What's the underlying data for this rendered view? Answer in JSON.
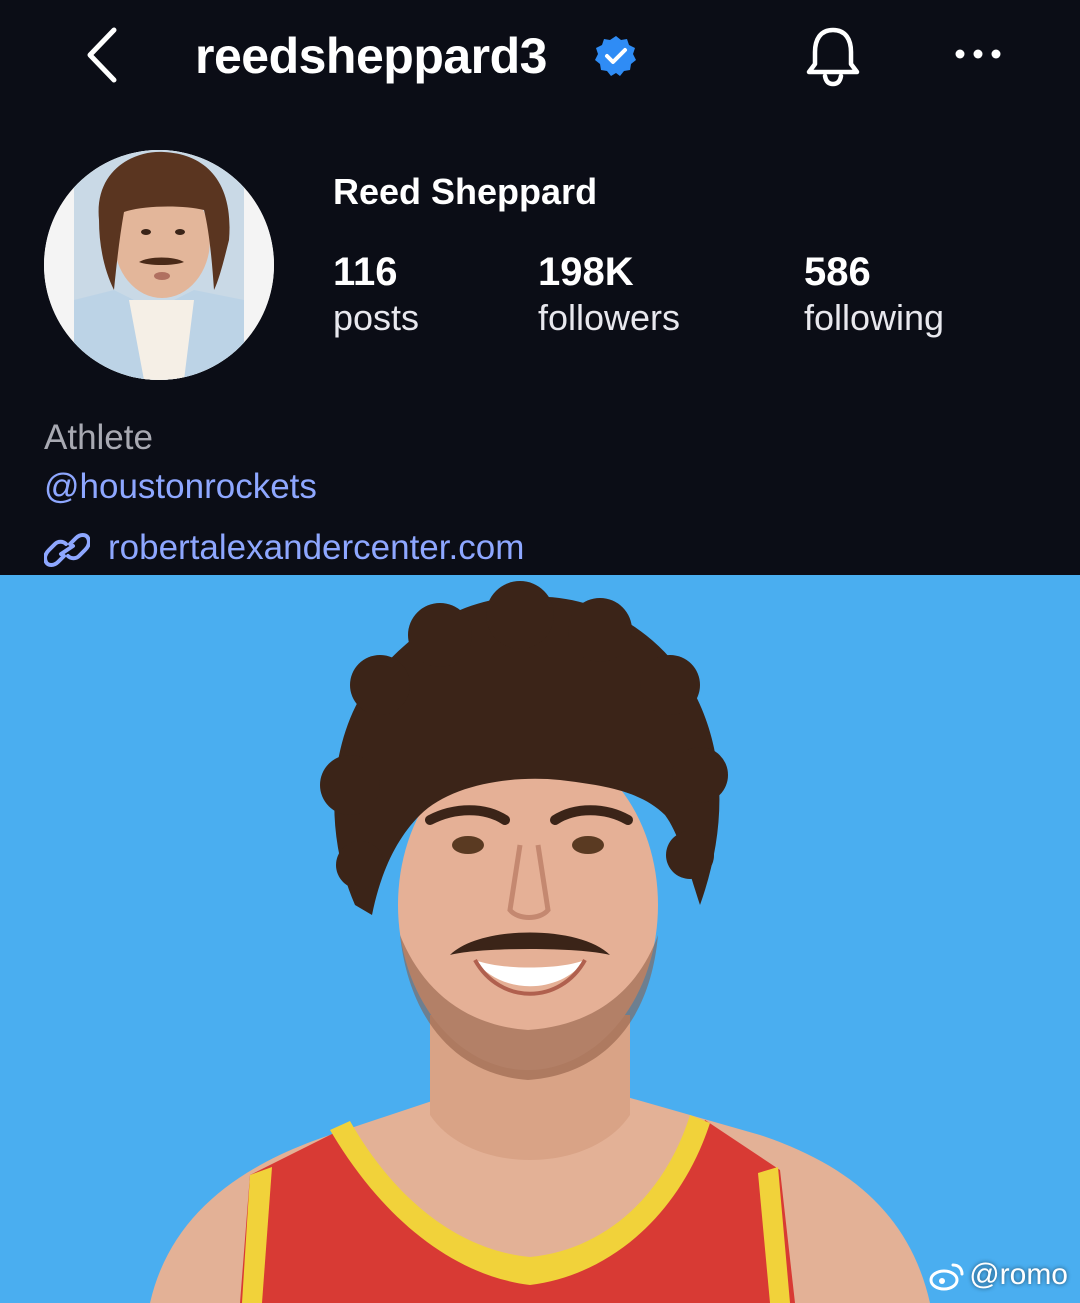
{
  "header": {
    "username": "reedsheppard3",
    "icons": {
      "back": "chevron-left-icon",
      "verified": "verified-badge-icon",
      "notifications": "bell-icon",
      "more": "more-horizontal-icon"
    }
  },
  "profile": {
    "display_name": "Reed Sheppard",
    "stats": {
      "posts": {
        "value": "116",
        "label": "posts"
      },
      "followers": {
        "value": "198K",
        "label": "followers"
      },
      "following": {
        "value": "586",
        "label": "following"
      }
    },
    "category": "Athlete",
    "mention": "@houstonrockets",
    "link": "robertalexandercenter.com"
  },
  "watermark": {
    "text": "@romo",
    "icon": "weibo-icon"
  },
  "colors": {
    "background": "#0b0d16",
    "link": "#8ea7ff",
    "verified": "#2f8cf5",
    "post_background": "#4aaef0"
  }
}
